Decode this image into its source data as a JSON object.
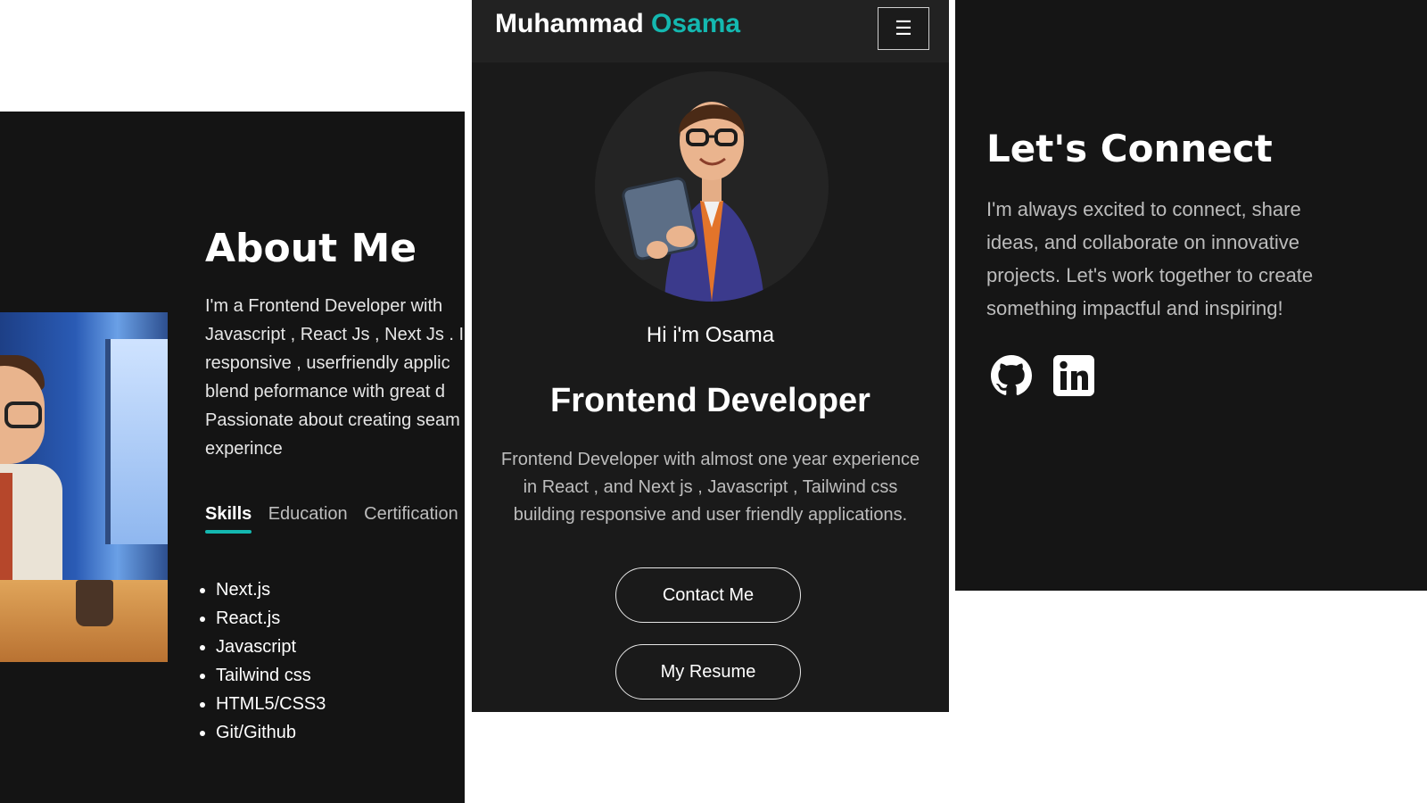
{
  "about": {
    "title": "About Me",
    "text_lines": [
      "I'm a Frontend Developer with",
      "Javascript , React Js , Next Js . I",
      "responsive , userfriendly applic",
      "blend peformance with great d",
      "Passionate about creating seam",
      "experince"
    ],
    "tabs": [
      "Skills",
      "Education",
      "Certification"
    ],
    "active_tab": "Skills",
    "skills": [
      "Next.js",
      "React.js",
      "Javascript",
      "Tailwind css",
      "HTML5/CSS3",
      "Git/Github"
    ]
  },
  "hero": {
    "brand_first": "Muhammad",
    "brand_second": "Osama",
    "menu_icon": "hamburger-icon",
    "greeting": "Hi i'm Osama",
    "role": "Frontend Developer",
    "description_lines": [
      "Frontend Developer with almost one year experience",
      "in React , and Next js , Javascript , Tailwind css",
      "building responsive and user friendly applications."
    ],
    "contact_label": "Contact Me",
    "resume_label": "My Resume"
  },
  "connect": {
    "title": "Let's Connect",
    "text_lines": [
      "I'm always excited to connect, share",
      "ideas, and collaborate on innovative",
      "projects. Let's work together to create",
      "something impactful and inspiring!"
    ],
    "social_icons": [
      "github-icon",
      "linkedin-icon"
    ]
  },
  "colors": {
    "accent": "#14b8b0",
    "background": "#141414",
    "text": "#ffffff"
  }
}
